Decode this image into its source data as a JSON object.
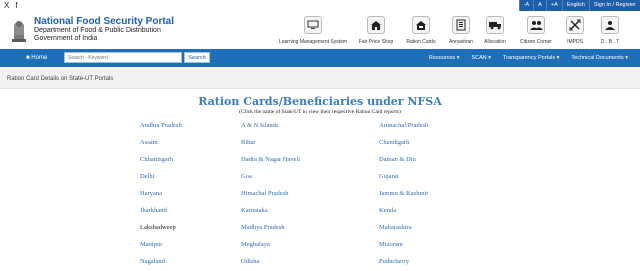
{
  "browser": {
    "social": [
      "X",
      "f"
    ]
  },
  "utility_bar": {
    "items": [
      "-A",
      "A",
      "+A",
      "English",
      "Sign In / Register"
    ]
  },
  "header": {
    "title": "National Food Security Portal",
    "dept": "Department of Food & Public Distribution",
    "govt": "Government of India"
  },
  "quick_links": [
    {
      "label": "Learning Management System",
      "icon": "monitor-icon"
    },
    {
      "label": "Fair Price Shop",
      "icon": "shop-icon"
    },
    {
      "label": "Ration Cards",
      "icon": "card-icon"
    },
    {
      "label": "Annavitran",
      "icon": "document-icon"
    },
    {
      "label": "Allocation",
      "icon": "truck-icon"
    },
    {
      "label": "Citizen Corner",
      "icon": "users-icon"
    },
    {
      "label": "IMPDS",
      "icon": "arrows-icon"
    },
    {
      "label": "D . B . T",
      "icon": "transfer-icon"
    }
  ],
  "nav": {
    "home": "Home",
    "search_placeholder": "Search - Keyword",
    "search_button": "Search",
    "menu": [
      "Resources",
      "SCAN",
      "Transparency Portals",
      "Technical Documents"
    ]
  },
  "breadcrumb": "Ration Card Details on State-UT Portals",
  "page": {
    "title": "Ration Cards/Beneficiaries under NFSA",
    "subtitle": "(Click the name of State/UT to view their respective Ration Card reports)"
  },
  "states": [
    [
      "Andhra Pradesh",
      "A & N Islands",
      "Arunachal Pradesh"
    ],
    [
      "Assam",
      "Bihar",
      "Chandigarh"
    ],
    [
      "Chhattisgarh",
      "Dadra & Nagar Haveli",
      "Daman & Diu"
    ],
    [
      "Delhi",
      "Goa",
      "Gujarat"
    ],
    [
      "Haryana",
      "Himachal Pradesh",
      "Jammu & Kashmir"
    ],
    [
      "Jharkhand",
      "Karnataka",
      "Kerala"
    ],
    [
      "Lakshadweep",
      "Madhya Pradesh",
      "Maharashtra"
    ],
    [
      "Manipur",
      "Meghalaya",
      "Mizoram"
    ],
    [
      "Nagaland",
      "Odisha",
      "Puducherry"
    ]
  ]
}
